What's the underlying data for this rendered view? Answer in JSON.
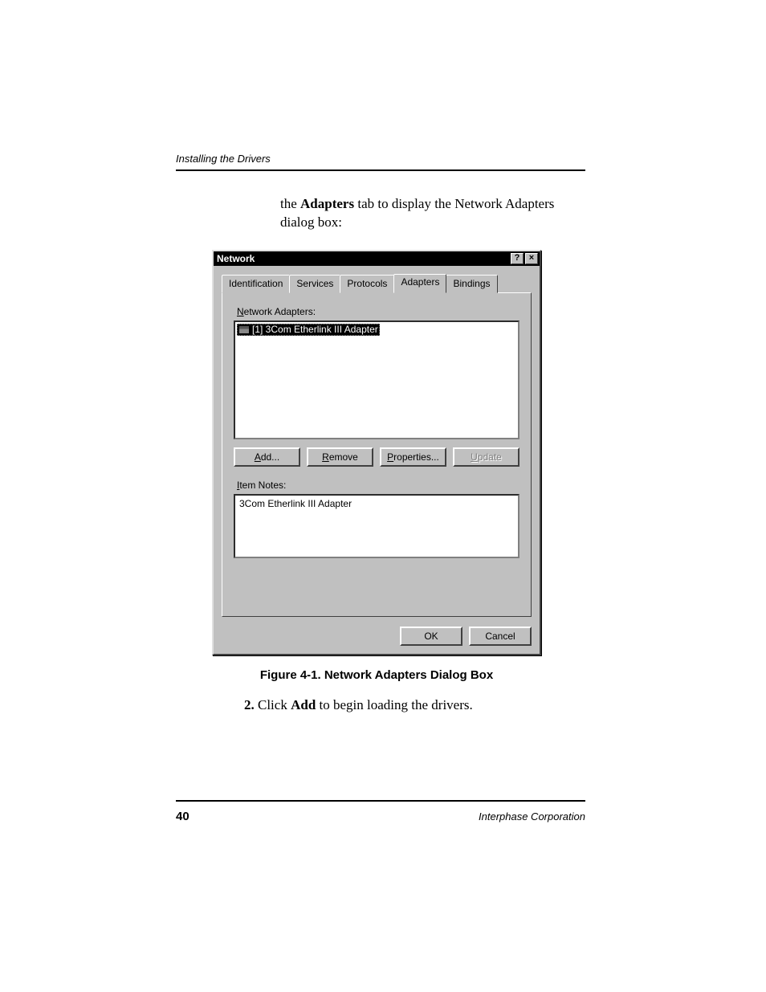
{
  "header": {
    "running_head": "Installing the Drivers"
  },
  "intro": {
    "before": "the ",
    "bold": "Adapters",
    "after": " tab to display the Network Adapters dialog box:"
  },
  "dialog": {
    "title": "Network",
    "help_glyph": "?",
    "close_glyph": "×",
    "tabs": [
      "Identification",
      "Services",
      "Protocols",
      "Adapters",
      "Bindings"
    ],
    "active_tab_index": 3,
    "adapters_label": {
      "accel": "N",
      "rest": "etwork Adapters:"
    },
    "adapter_item": "[1] 3Com Etherlink III Adapter",
    "buttons": {
      "add": {
        "accel": "A",
        "rest": "dd..."
      },
      "remove": {
        "accel": "R",
        "rest": "emove"
      },
      "properties": {
        "accel": "P",
        "rest": "roperties..."
      },
      "update": {
        "accel": "U",
        "rest": "pdate"
      }
    },
    "notes_label": {
      "accel": "I",
      "rest": "tem Notes:"
    },
    "notes_text": "3Com Etherlink III Adapter",
    "ok": "OK",
    "cancel": "Cancel"
  },
  "caption": "Figure 4-1.  Network Adapters Dialog Box",
  "step": {
    "num": "2.",
    "before": " Click ",
    "bold": "Add",
    "after": " to begin loading the drivers."
  },
  "footer": {
    "page": "40",
    "company": "Interphase Corporation"
  }
}
